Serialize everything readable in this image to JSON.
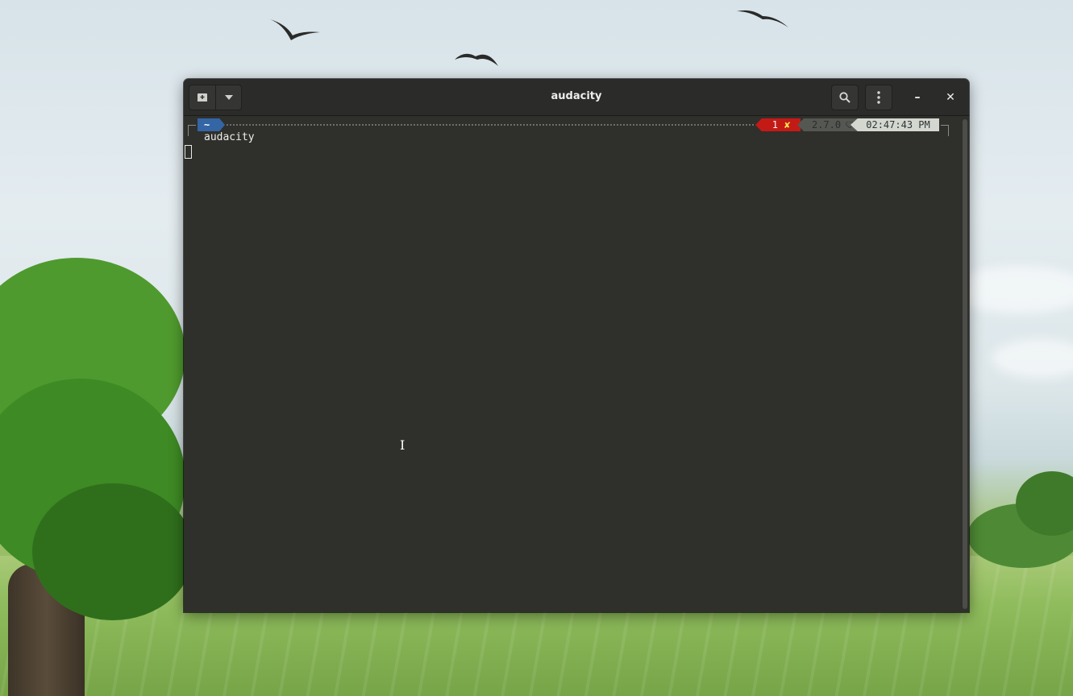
{
  "window": {
    "title": "audacity"
  },
  "headerbar": {
    "new_tab_icon": "new-tab-icon",
    "menu_dropdown_icon": "chevron-down-icon",
    "search_icon": "search-icon",
    "menu_icon": "vertical-ellipsis-icon",
    "minimize_label": "–",
    "close_label": "✕"
  },
  "prompt": {
    "dir": "~",
    "exit_code": "1",
    "error_mark": "✘",
    "ruby_version": "2.7.0",
    "ruby_icon": "ruby-gem-icon",
    "time": "02:47:43 PM",
    "colors": {
      "dir_bg": "#3465a4",
      "error_bg": "#c41a16",
      "version_bg": "#555753",
      "time_bg": "#d3d7cf"
    }
  },
  "terminal": {
    "output_line": "audacity"
  }
}
